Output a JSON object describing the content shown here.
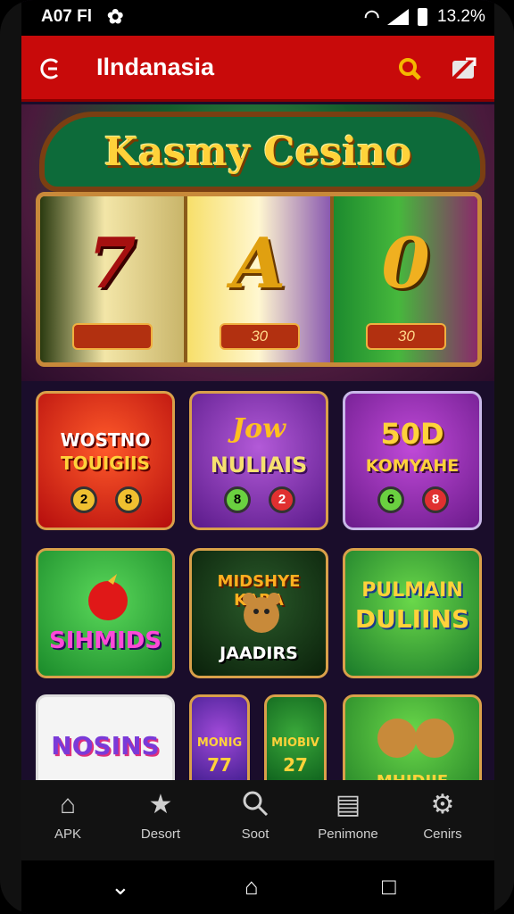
{
  "status_bar": {
    "time": "A07 Fl",
    "battery_pct": "13.2%"
  },
  "app_bar": {
    "title": "Ilndanasia"
  },
  "hero": {
    "brand": "Kasmy Cesino",
    "reels": [
      "7",
      "A",
      "0"
    ],
    "reel_plates": [
      "",
      "30",
      "30"
    ]
  },
  "tiles": [
    {
      "line1": "WOSTNO",
      "line2": "TOUIGIIS",
      "coins": [
        "2",
        "8"
      ]
    },
    {
      "line1": "Jow",
      "line2": "NULIAIS",
      "coins": [
        "8",
        "2"
      ]
    },
    {
      "line1": "50D",
      "line2": "KOMYAHE",
      "coins": [
        "6",
        "8"
      ]
    },
    {
      "line1": "",
      "line2": "SIHMIDS",
      "coins": []
    },
    {
      "line1": "MIDSHYE KARA",
      "line2": "JAADIRS",
      "coins": []
    },
    {
      "line1": "PULMAIN",
      "line2": "DULIINS",
      "coins": []
    },
    {
      "line1": "NOSINS",
      "line2": "",
      "coins": []
    },
    {
      "line1": "MONIG",
      "line2": "77",
      "coins": []
    },
    {
      "line1": "MIOBIV",
      "line2": "27",
      "coins": []
    },
    {
      "line1": "",
      "line2": "MHIDIIE",
      "coins": []
    }
  ],
  "bottom_nav": [
    {
      "label": "APK",
      "icon": "home-icon"
    },
    {
      "label": "Desort",
      "icon": "star-icon"
    },
    {
      "label": "Soot",
      "icon": "search-icon"
    },
    {
      "label": "Penimone",
      "icon": "document-icon"
    },
    {
      "label": "Cenirs",
      "icon": "gear-icon"
    }
  ],
  "colors": {
    "appbar": "#c80a0a",
    "accent_gold": "#ffd23a"
  }
}
